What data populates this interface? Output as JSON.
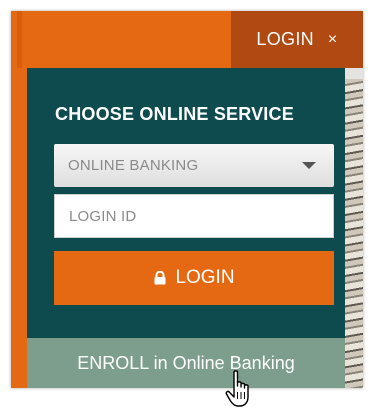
{
  "header": {
    "login_tab_label": "LOGIN",
    "close_glyph": "×"
  },
  "panel": {
    "title": "CHOOSE ONLINE SERVICE",
    "service_select": {
      "selected": "ONLINE BANKING",
      "icon": "chevron-down-icon"
    },
    "login_id_field": {
      "placeholder": "LOGIN ID",
      "value": ""
    },
    "login_button": {
      "label": "LOGIN",
      "icon": "lock-icon"
    }
  },
  "enroll_link": {
    "label": "ENROLL in Online Banking"
  },
  "colors": {
    "orange": "#e56913",
    "dark_orange": "#b14912",
    "teal_panel": "#0d4b4f",
    "enroll_green": "#7d9e8d"
  },
  "cursor": "hand-pointer-icon"
}
